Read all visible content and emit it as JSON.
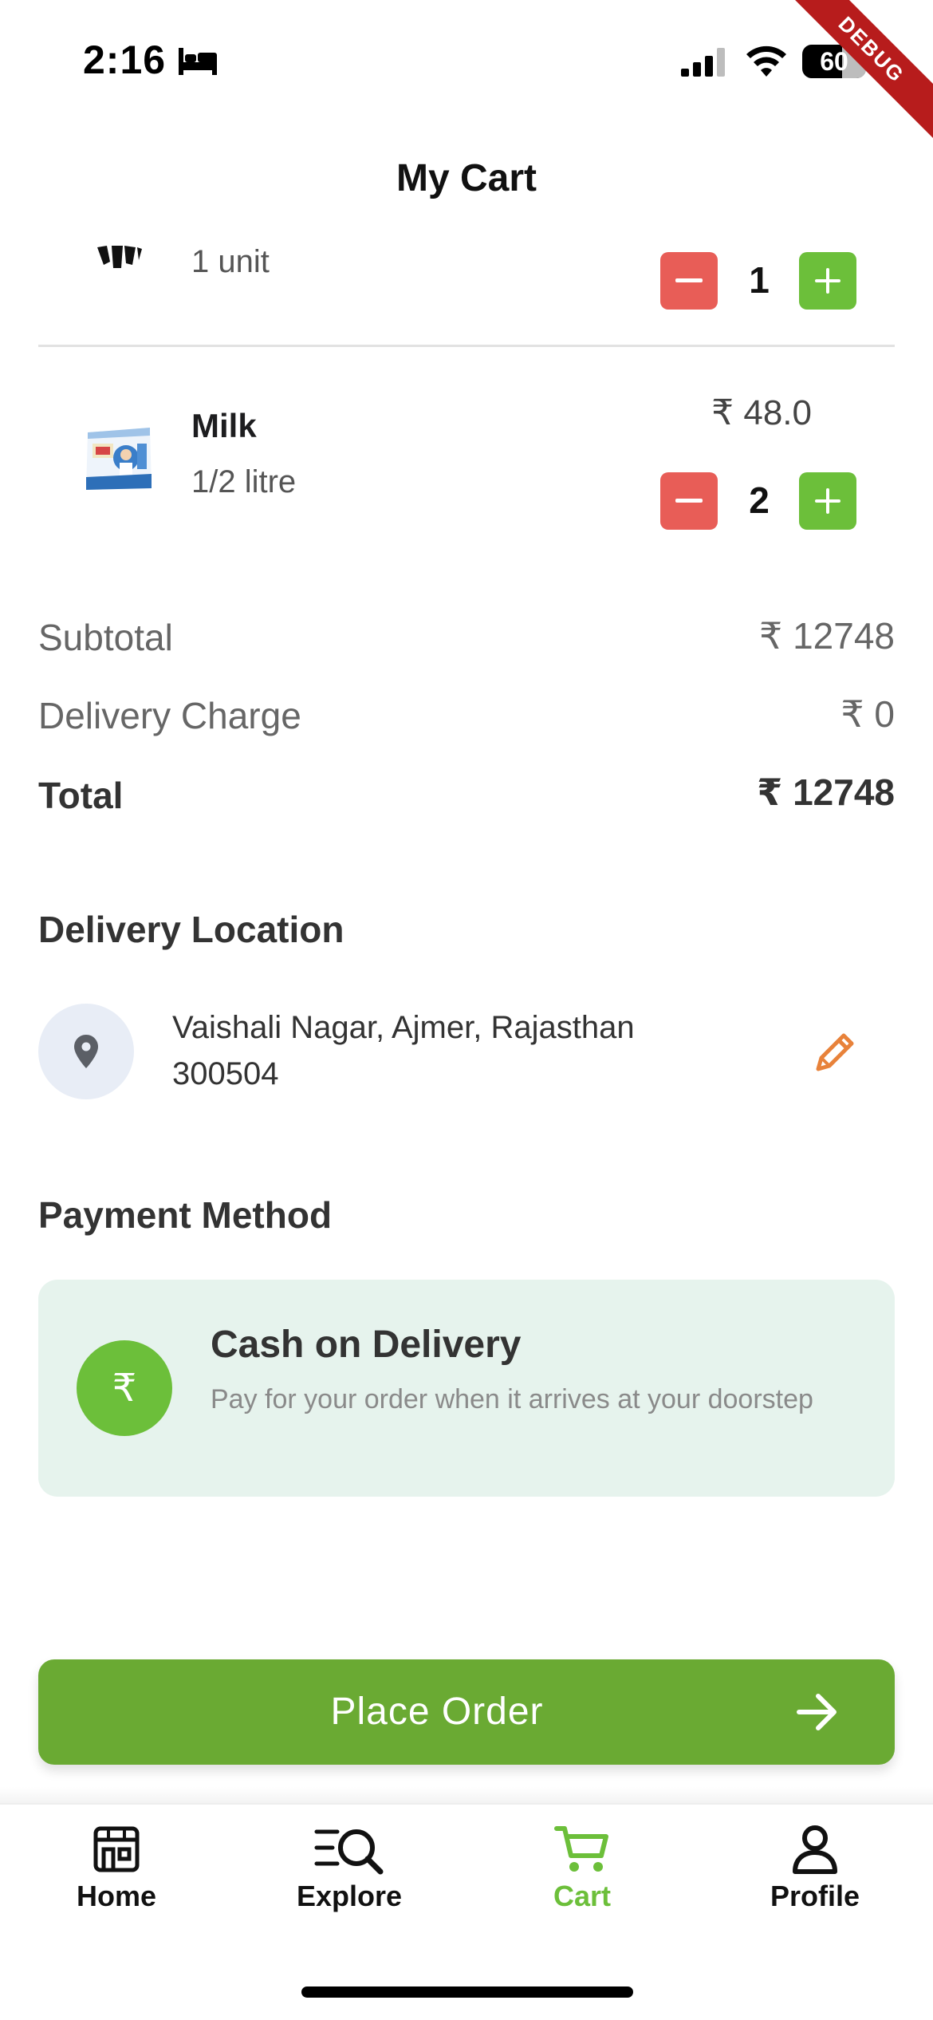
{
  "status_bar": {
    "time": "2:16",
    "battery": "60",
    "debug_label": "DEBUG"
  },
  "header": {
    "title": "My Cart"
  },
  "cart_items": [
    {
      "name": "",
      "unit": "1 unit",
      "price": "",
      "quantity": "1"
    },
    {
      "name": "Milk",
      "unit": "1/2 litre",
      "price": "₹ 48.0",
      "quantity": "2"
    }
  ],
  "summary": {
    "subtotal_label": "Subtotal",
    "subtotal_value": "₹ 12748",
    "delivery_label": "Delivery Charge",
    "delivery_value": "₹ 0",
    "total_label": "Total",
    "total_value": "₹ 12748"
  },
  "delivery": {
    "title": "Delivery Location",
    "address_line1": "Vaishali Nagar, Ajmer, Rajasthan",
    "address_line2": "300504"
  },
  "payment": {
    "title": "Payment Method",
    "method_title": "Cash on Delivery",
    "method_description": "Pay for your order when it arrives at your doorstep",
    "method_symbol": "₹"
  },
  "actions": {
    "place_order_label": "Place Order"
  },
  "bottom_nav": {
    "items": [
      {
        "label": "Home",
        "icon": "store-icon",
        "active": false
      },
      {
        "label": "Explore",
        "icon": "search-list-icon",
        "active": false
      },
      {
        "label": "Cart",
        "icon": "cart-icon",
        "active": true
      },
      {
        "label": "Profile",
        "icon": "person-icon",
        "active": false
      }
    ]
  },
  "colors": {
    "accent_green": "#6cbf3a",
    "button_green": "#6aaa33",
    "minus_red": "#e85d57",
    "edit_orange": "#e8823a",
    "payment_bg": "#e6f3ed"
  }
}
